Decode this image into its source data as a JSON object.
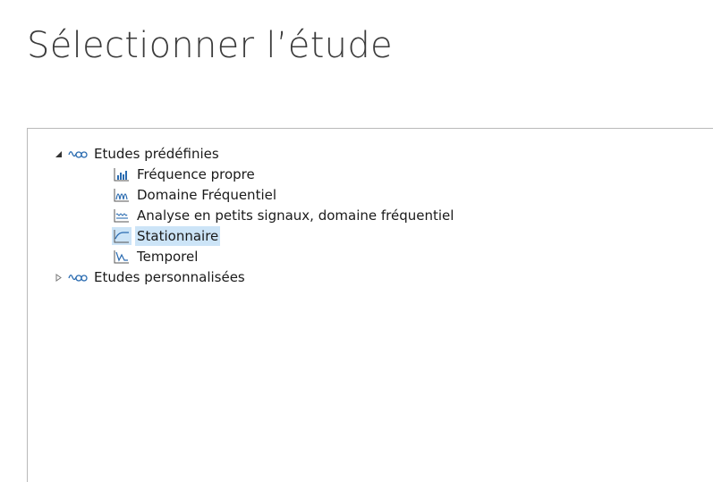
{
  "title": "Sélectionner l’étude",
  "tree": {
    "predefined": {
      "label": "Etudes prédéfinies",
      "expanded": true,
      "items": [
        {
          "label": "Fréquence propre",
          "icon": "eigenfrequency-icon"
        },
        {
          "label": "Domaine Fréquentiel",
          "icon": "frequency-domain-icon"
        },
        {
          "label": "Analyse en petits signaux, domaine fréquentiel",
          "icon": "small-signal-icon"
        },
        {
          "label": "Stationnaire",
          "icon": "stationary-icon",
          "selected": true
        },
        {
          "label": "Temporel",
          "icon": "time-dependent-icon"
        }
      ]
    },
    "custom": {
      "label": "Etudes personnalisées",
      "expanded": false
    }
  },
  "colors": {
    "selection": "#cce4f7",
    "icon_blue": "#2a6bb0",
    "title_text": "#3b3b3b",
    "panel_border": "#b9b9b9"
  }
}
